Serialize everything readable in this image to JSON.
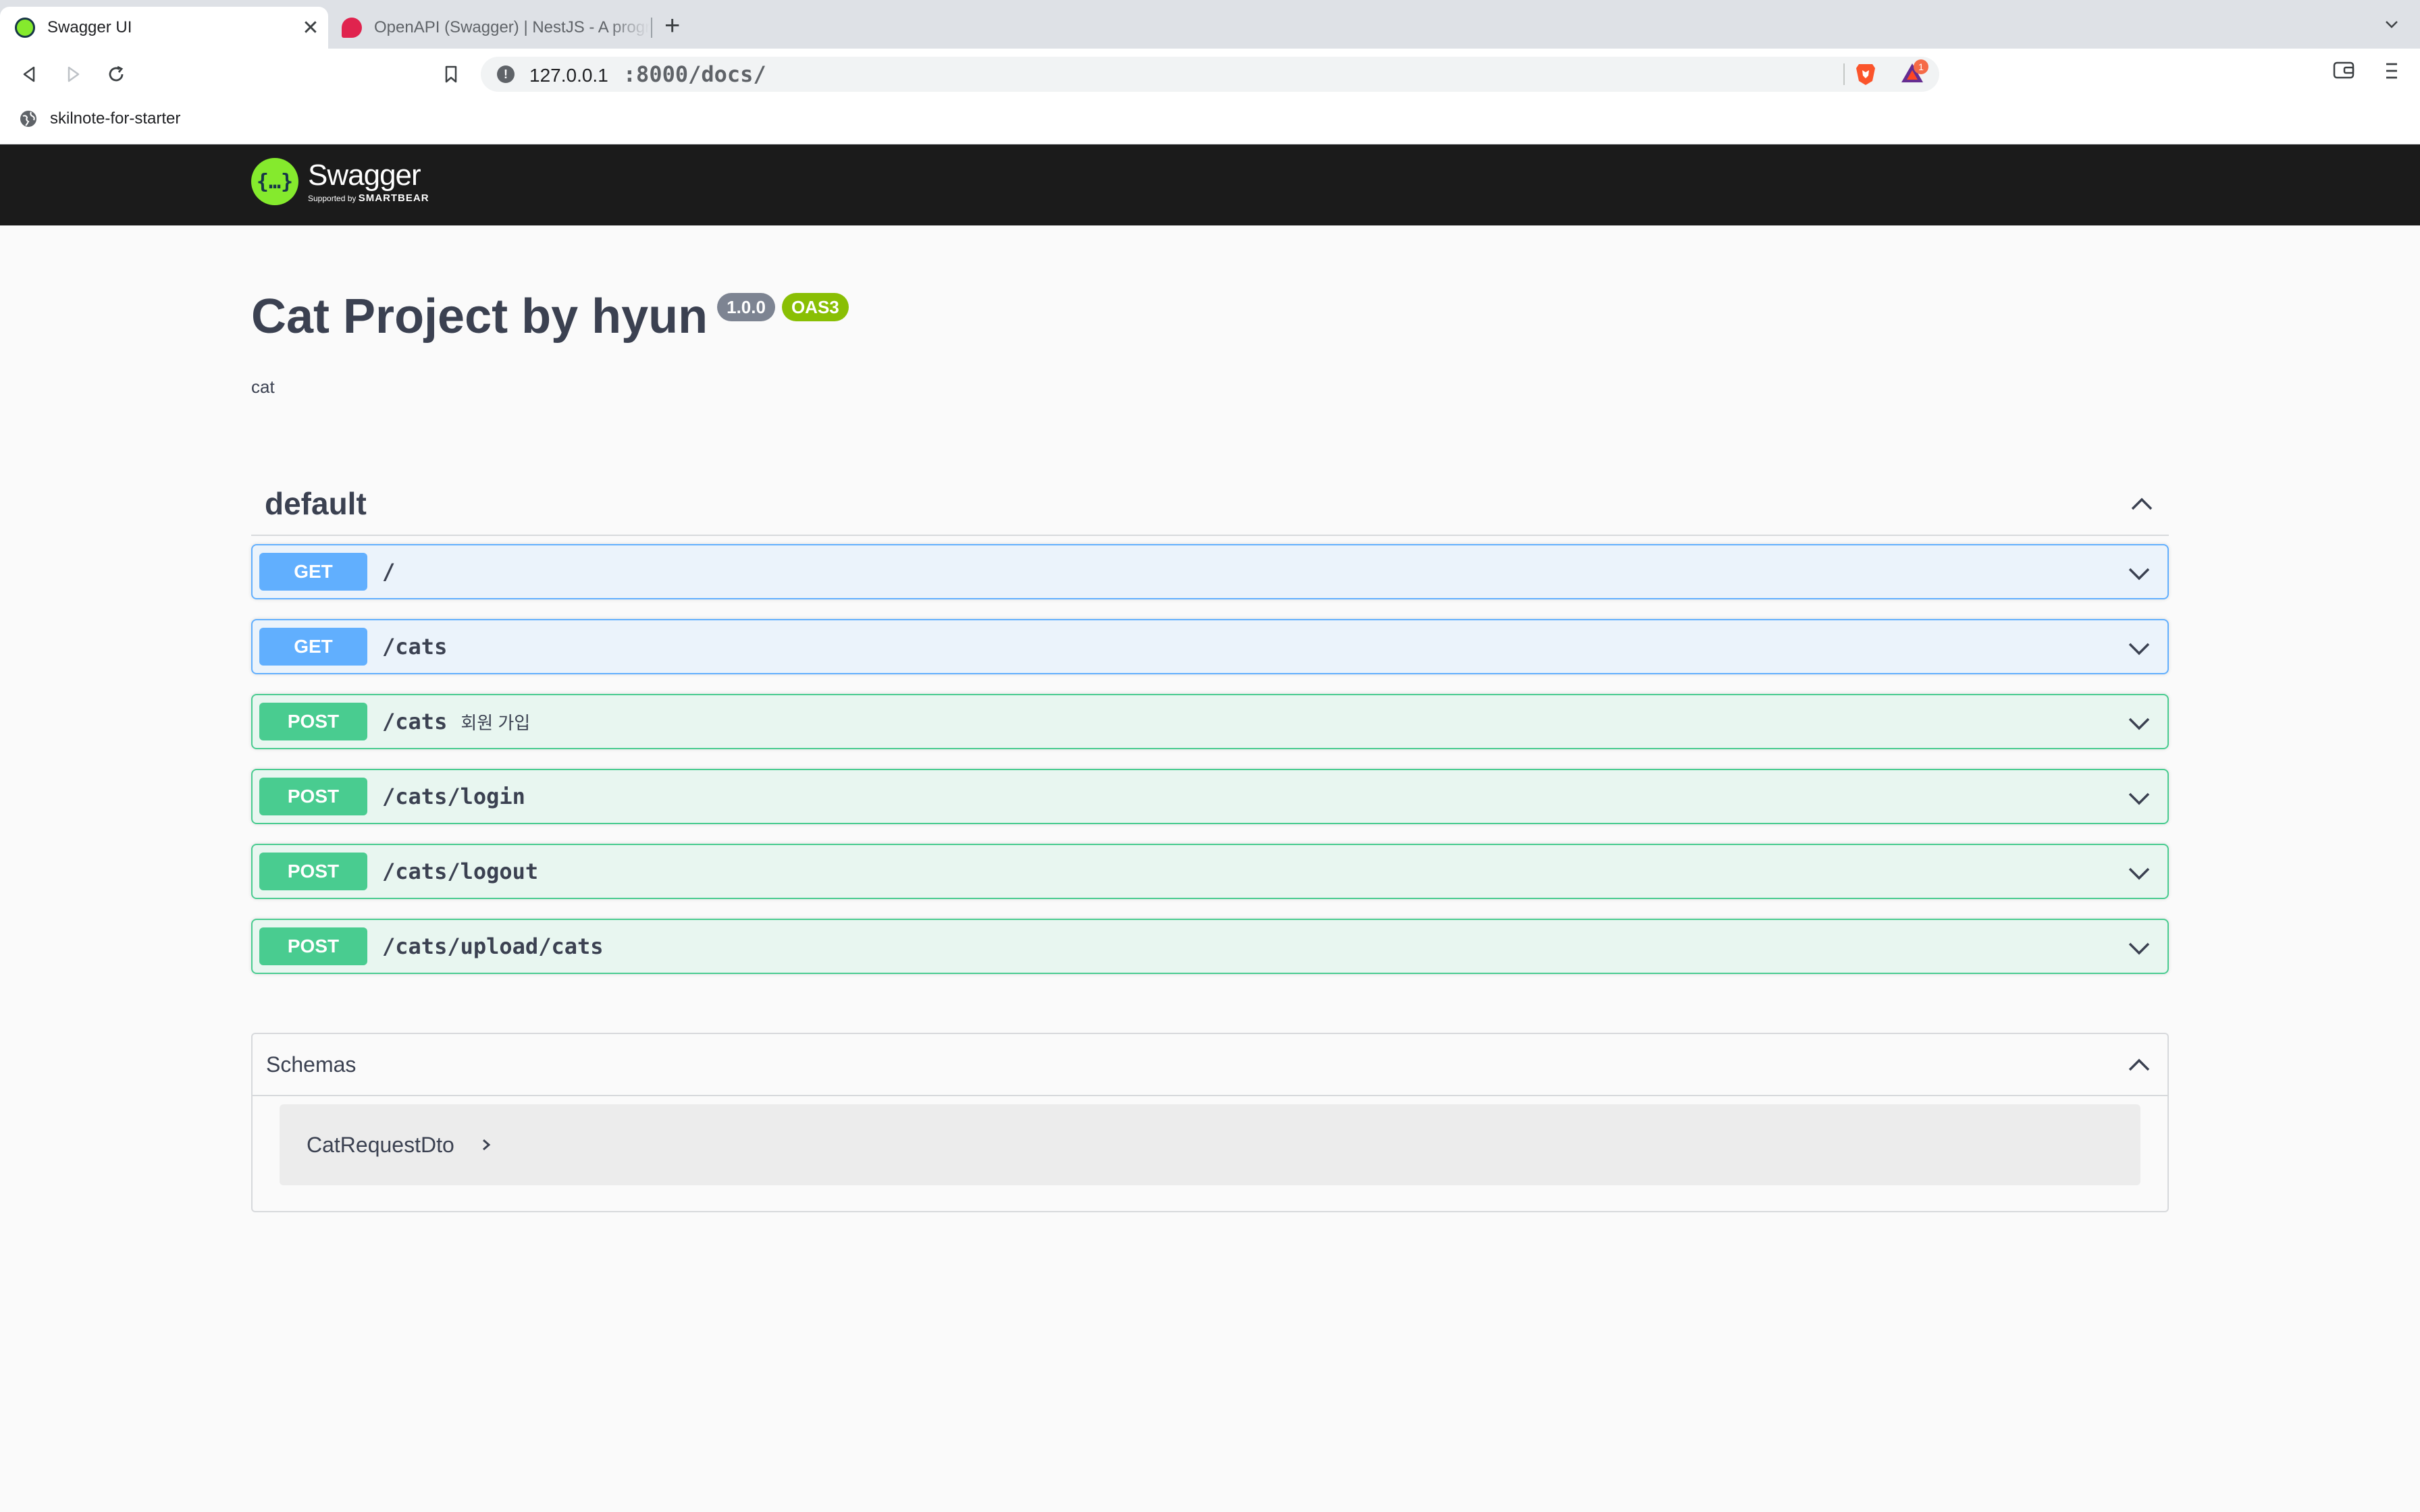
{
  "browser": {
    "tabs": [
      {
        "title": "Swagger UI",
        "active": true
      },
      {
        "title": "OpenAPI (Swagger) | NestJS - A progressive Node.js framework",
        "active": false
      }
    ],
    "close_glyph": "✕",
    "new_tab_glyph": "+",
    "url_host": "127.0.0.1",
    "url_rest": ":8000/docs/",
    "bat_badge_count": "1",
    "bookmarks": [
      {
        "label": "skilnote-for-starter"
      }
    ]
  },
  "swagger": {
    "logo_text": "Swagger",
    "logo_glyph": "{…}",
    "supported_by": "Supported by",
    "smartbear": "SMARTBEAR"
  },
  "info": {
    "title": "Cat Project by hyun",
    "version": "1.0.0",
    "oas": "OAS3",
    "description": "cat"
  },
  "tag": {
    "name": "default",
    "operations": [
      {
        "method": "GET",
        "path": "/",
        "summary": ""
      },
      {
        "method": "GET",
        "path": "/cats",
        "summary": ""
      },
      {
        "method": "POST",
        "path": "/cats",
        "summary": "회원 가입"
      },
      {
        "method": "POST",
        "path": "/cats/login",
        "summary": ""
      },
      {
        "method": "POST",
        "path": "/cats/logout",
        "summary": ""
      },
      {
        "method": "POST",
        "path": "/cats/upload/cats",
        "summary": ""
      }
    ]
  },
  "schemas": {
    "title": "Schemas",
    "items": [
      {
        "name": "CatRequestDto"
      }
    ]
  },
  "colors": {
    "get": "#61affe",
    "post": "#49cc90",
    "topbar": "#1b1b1b",
    "swagger_green": "#85ea2d"
  }
}
